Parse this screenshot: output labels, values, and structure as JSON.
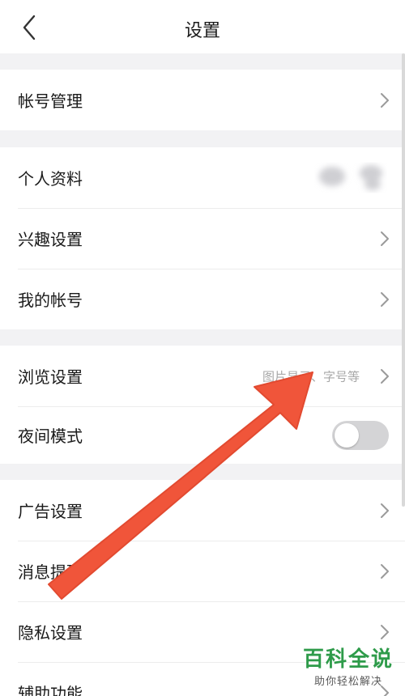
{
  "header": {
    "title": "设置"
  },
  "groups": [
    {
      "items": [
        {
          "label": "帐号管理"
        }
      ]
    },
    {
      "items": [
        {
          "label": "个人资料"
        },
        {
          "label": "兴趣设置"
        },
        {
          "label": "我的帐号"
        }
      ]
    },
    {
      "items": [
        {
          "label": "浏览设置",
          "hint": "图片显示、字号等"
        },
        {
          "label": "夜间模式",
          "toggle_on": false
        }
      ]
    },
    {
      "items": [
        {
          "label": "广告设置"
        },
        {
          "label": "消息提醒"
        },
        {
          "label": "隐私设置"
        },
        {
          "label": "辅助功能"
        }
      ]
    }
  ],
  "watermark": {
    "title": "百科全说",
    "subtitle": "助你轻松解决"
  },
  "colors": {
    "page_bg": "#f2f2f4",
    "annotation_arrow": "#f0553a",
    "watermark_green": "#2e9b4a",
    "toggle_off": "#d4d4d6"
  },
  "icons": {
    "back": "chevron-left-icon",
    "row": "chevron-right-icon"
  }
}
